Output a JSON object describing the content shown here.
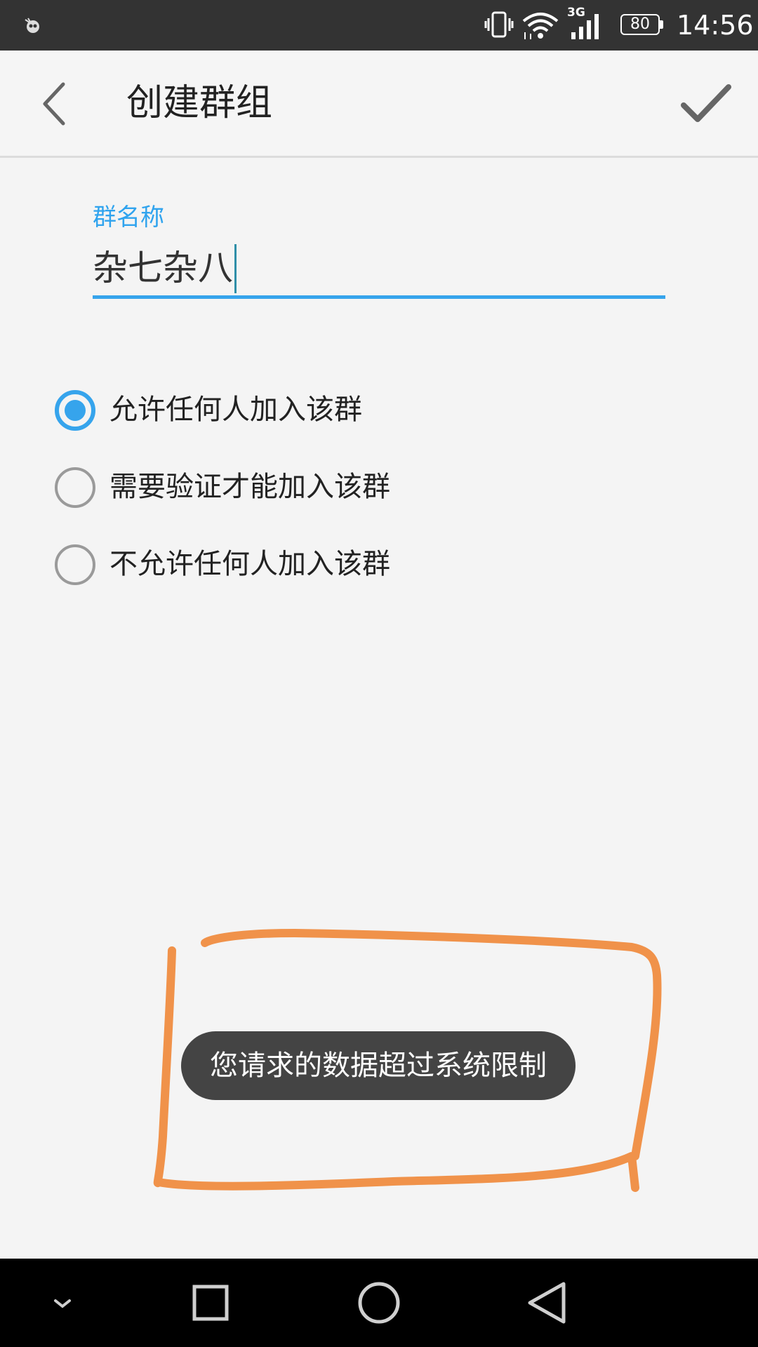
{
  "status_bar": {
    "network_type": "3G",
    "battery_level": "80",
    "time": "14:56",
    "icons": [
      "app-notification-icon",
      "vibrate-icon",
      "wifi-icon",
      "signal-icon",
      "battery-icon"
    ]
  },
  "toolbar": {
    "title": "创建群组",
    "back_icon": "chevron-left-icon",
    "confirm_icon": "checkmark-icon"
  },
  "group_name": {
    "label": "群名称",
    "value": "杂七杂八"
  },
  "join_options": [
    {
      "label": "允许任何人加入该群",
      "selected": true
    },
    {
      "label": "需要验证才能加入该群",
      "selected": false
    },
    {
      "label": "不允许任何人加入该群",
      "selected": false
    }
  ],
  "toast": {
    "message": "您请求的数据超过系统限制"
  },
  "nav_bar": {
    "icons": [
      "hide-nav-icon",
      "recents-square-icon",
      "home-circle-icon",
      "back-triangle-icon"
    ]
  },
  "colors": {
    "accent": "#36a4ec",
    "annotation": "#f0924a",
    "toast_bg": "#444444",
    "status_bar_bg": "#333333"
  }
}
